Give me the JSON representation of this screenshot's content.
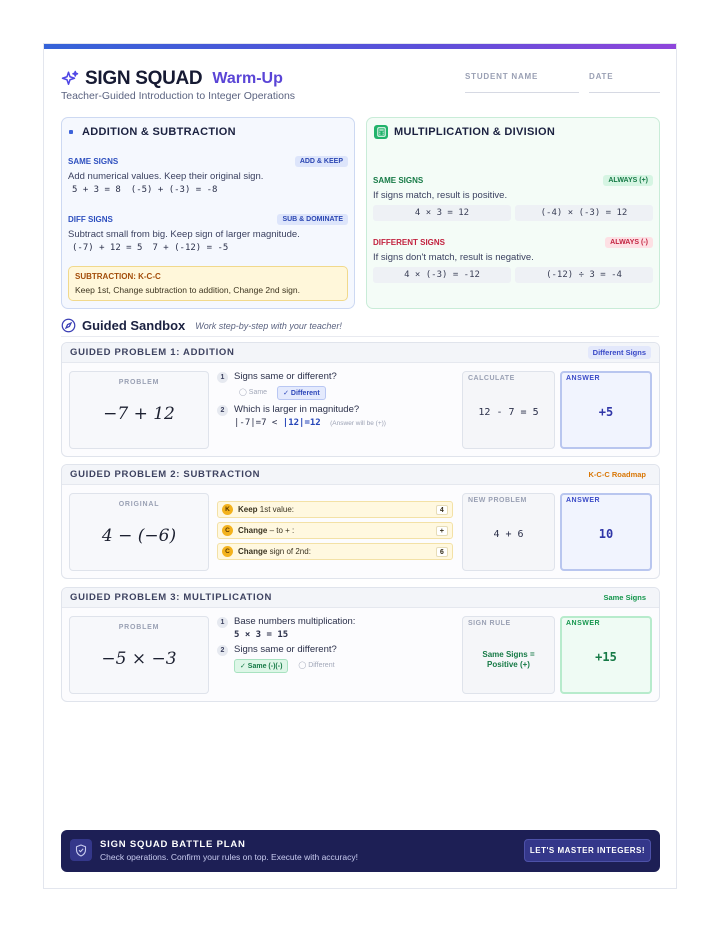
{
  "header": {
    "title": "SIGN SQUAD",
    "title_sub": "Warm-Up",
    "subtitle": "Teacher-Guided Introduction to Integer Operations",
    "student_label": "STUDENT NAME",
    "date_label": "DATE",
    "icon": "sparkles-icon"
  },
  "rules": {
    "add_sub": {
      "title": "ADDITION & SUBTRACTION",
      "same": {
        "label": "SAME SIGNS",
        "pill": "ADD & KEEP",
        "text": "Add numerical values. Keep their original sign.",
        "ex1": "5 + 3 = 8",
        "ex2": "(-5) + (-3) = -8"
      },
      "diff": {
        "label": "DIFF SIGNS",
        "pill": "SUB & DOMINATE",
        "text": "Subtract small from big. Keep sign of larger magnitude.",
        "ex1": "(-7) + 12 = 5",
        "ex2": "7 + (-12) = -5"
      },
      "kcc": {
        "title": "SUBTRACTION: K-C-C",
        "text": "Keep 1st, Change subtraction to addition, Change 2nd sign."
      }
    },
    "mul_div": {
      "title": "MULTIPLICATION & DIVISION",
      "icon": "calculator-icon",
      "same": {
        "label": "SAME SIGNS",
        "pill": "ALWAYS (+)",
        "text": "If signs match, result is positive.",
        "ex1": "4 × 3 = 12",
        "ex2": "(-4) × (-3) = 12"
      },
      "diff": {
        "label": "DIFFERENT SIGNS",
        "pill": "ALWAYS (-)",
        "text": "If signs don't match, result is negative.",
        "ex1": "4 × (-3) = -12",
        "ex2": "(-12) ÷ 3 = -4"
      }
    }
  },
  "sandbox": {
    "title": "Guided Sandbox",
    "subtitle": "Work step-by-step with your teacher!",
    "icon": "compass-icon"
  },
  "problems": [
    {
      "title": "GUIDED PROBLEM 1: ADDITION",
      "tag": "Different Signs",
      "box_label": "PROBLEM",
      "expr": "−7 + 12",
      "step1": "Signs same or different?",
      "chip_a": "◯ Same",
      "chip_b": "✓ Different",
      "step2": "Which is larger in magnitude?",
      "mag_a": "|-7|=7 <",
      "mag_b": "|12|=12",
      "mag_note": "(Answer will be (+))",
      "calc_label": "CALCULATE",
      "calc_value": "12 - 7 = 5",
      "answer_label": "ANSWER",
      "answer": "+5"
    },
    {
      "title": "GUIDED PROBLEM 2: SUBTRACTION",
      "tag": "K-C-C Roadmap",
      "box_label": "ORIGINAL",
      "expr": "4 − (−6)",
      "steps": [
        {
          "badge": "K",
          "bold": "Keep",
          "rest": " 1st value:",
          "value": "4"
        },
        {
          "badge": "C",
          "bold": "Change",
          "rest": " – to + :",
          "value": "+"
        },
        {
          "badge": "C",
          "bold": "Change",
          "rest": " sign of 2nd:",
          "value": "6"
        }
      ],
      "calc_label": "NEW PROBLEM",
      "calc_value": "4 + 6",
      "answer_label": "ANSWER",
      "answer": "10"
    },
    {
      "title": "GUIDED PROBLEM 3: MULTIPLICATION",
      "tag": "Same Signs",
      "box_label": "PROBLEM",
      "expr": "−5 × −3",
      "step1": "Base numbers multiplication:",
      "step1_value": "5 × 3 = 15",
      "step2": "Signs same or different?",
      "chip_a": "✓ Same (-)(-)",
      "chip_b": "◯ Different",
      "calc_label": "SIGN RULE",
      "calc_value": "Same Signs = Positive (+)",
      "answer_label": "ANSWER",
      "answer": "+15"
    }
  ],
  "footer": {
    "title": "SIGN SQUAD BATTLE PLAN",
    "text": "Check operations. Confirm your rules on top. Execute with accuracy!",
    "button": "LET'S MASTER INTEGERS!",
    "icon": "shield-icon"
  },
  "colors": {
    "accent": "#5a45d6",
    "blue": "#3d63d9",
    "green": "#22b36b",
    "navy": "#1d1f55"
  }
}
